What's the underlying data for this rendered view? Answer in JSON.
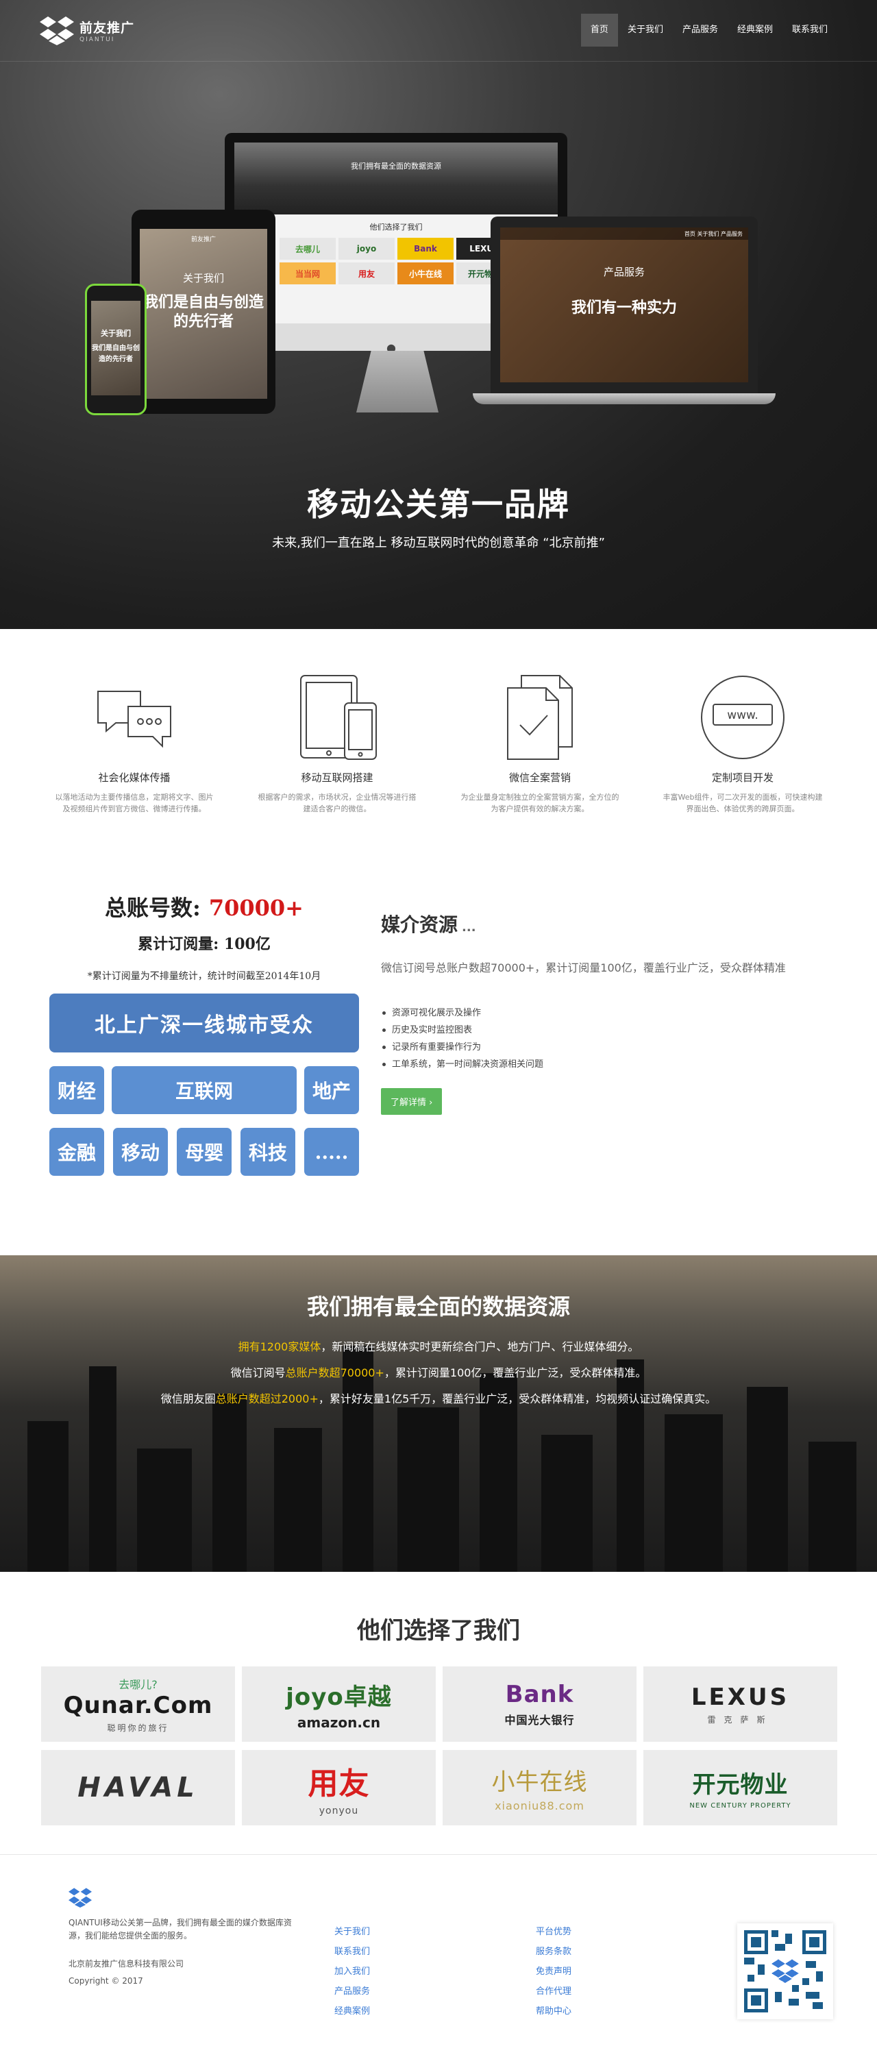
{
  "nav": {
    "logo_cn": "前友推广",
    "logo_en": "QIANTUI",
    "items": [
      {
        "label": "首页",
        "active": true
      },
      {
        "label": "关于我们"
      },
      {
        "label": "产品服务"
      },
      {
        "label": "经典案例"
      },
      {
        "label": "联系我们"
      }
    ]
  },
  "hero": {
    "title": "移动公关第一品牌",
    "subtitle": "未来,我们一直在路上 移动互联网时代的创意革命 “北京前推”",
    "imac_heading": "我们拥有最全面的数据资源",
    "imac_chose": "他们选择了我们",
    "imac_logos": [
      "去哪儿",
      "joyo",
      "Bank",
      "LEXUS",
      "当当网",
      "用友",
      "小牛在线",
      "开元物业"
    ],
    "laptop_nav": "首页 关于我们 产品服务",
    "laptop_title": "产品服务",
    "laptop_slogan": "我们有一种实力",
    "tablet_logo": "前友推广",
    "tablet_title": "关于我们",
    "tablet_slogan": "我们是自由与创造的先行者",
    "phone_title": "关于我们",
    "phone_slogan": "我们是自由与创造的先行者"
  },
  "services": [
    {
      "icon": "chat-bubbles-icon",
      "title": "社会化媒体传播",
      "desc": "以落地活动为主要传播信息，定期将文字、图片及视频组片传到官方微信、微博进行传播。"
    },
    {
      "icon": "devices-icon",
      "title": "移动互联网搭建",
      "desc": "根据客户的需求，市场状况，企业情况等进行搭建适合客户的微信。"
    },
    {
      "icon": "document-check-icon",
      "title": "微信全案营销",
      "desc": "为企业量身定制独立的全案营销方案，全方位的为客户提供有效的解决方案。"
    },
    {
      "icon": "www-globe-icon",
      "title": "定制项目开发",
      "desc": "丰富Web组件，可二次开发的面板，可快速构建界面出色、体验优秀的跨屏页面。"
    }
  ],
  "stats": {
    "total_label": "总账号数:",
    "total_value": "70000+",
    "read": "累计订阅量: 100亿",
    "note": "*累计订阅量为不排量统计，统计时间截至2014年10月",
    "wide_tag": "北上广深一线城市受众",
    "row1": [
      "财经",
      "互联网",
      "地产"
    ],
    "row2": [
      "金融",
      "移动",
      "母婴",
      "科技",
      "....."
    ]
  },
  "media": {
    "title": "媒介资源",
    "title_suffix": "...",
    "desc": "微信订阅号总账户数超70000+，累计订阅量100亿，覆盖行业广泛，受众群体精准",
    "list": [
      "资源可视化展示及操作",
      "历史及实时监控图表",
      "记录所有重要操作行为",
      "工单系统，第一时间解决资源相关问题"
    ],
    "button": "了解详情"
  },
  "data_banner": {
    "title": "我们拥有最全面的数据资源",
    "line1_hl": "拥有1200家媒体",
    "line1_rest": "，新闻稿在线媒体实时更新综合门户、地方门户、行业媒体细分。",
    "line2_pre": "微信订阅号",
    "line2_hl": "总账户数超70000+",
    "line2_rest": "，累计订阅量100亿，覆盖行业广泛，受众群体精准。",
    "line3_pre": "微信朋友圈",
    "line3_hl": "总账户数超过2000+",
    "line3_rest": "，累计好友量1亿5千万，覆盖行业广泛，受众群体精准，均视频认证过确保真实。"
  },
  "clients": {
    "title": "他们选择了我们",
    "logos": [
      {
        "main": "Qunar.Com",
        "top": "去哪儿?",
        "sub": "聪明你的旅行",
        "color": "#1a1a1a"
      },
      {
        "main": "joyo卓越",
        "sub": "amazon.cn",
        "color": "#2a6e2a"
      },
      {
        "main": "Bank",
        "sub": "中国光大银行",
        "color": "#6b2a85"
      },
      {
        "main": "LEXUS",
        "sub": "雷克萨斯",
        "color": "#222222"
      },
      {
        "main": "HAVAL",
        "sub": "",
        "color": "#333333"
      },
      {
        "main": "用友",
        "sub": "yonyou",
        "color": "#d81e1e"
      },
      {
        "main": "小牛在线",
        "sub": "xiaoniu88.com",
        "color": "#b79a3c"
      },
      {
        "main": "开元物业",
        "sub": "NEW CENTURY PROPERTY",
        "color": "#1a5c2a"
      }
    ]
  },
  "footer": {
    "desc": "QIANTUI移动公关第一品牌，我们拥有最全面的媒介数据库资源，我们能给您提供全面的服务。",
    "company": "北京前友推广信息科技有限公司",
    "copyright": "Copyright © 2017",
    "col1": [
      "关于我们",
      "联系我们",
      "加入我们",
      "产品服务",
      "经典案例"
    ],
    "col2": [
      "平台优势",
      "服务条款",
      "免责声明",
      "合作代理",
      "帮助中心"
    ]
  },
  "colors": {
    "accent_blue": "#4d7dbf",
    "tag_blue": "#5b8fd2",
    "red": "#d21a1a",
    "green": "#5cb85c",
    "highlight": "#f2c400",
    "link": "#3a7bd5"
  }
}
